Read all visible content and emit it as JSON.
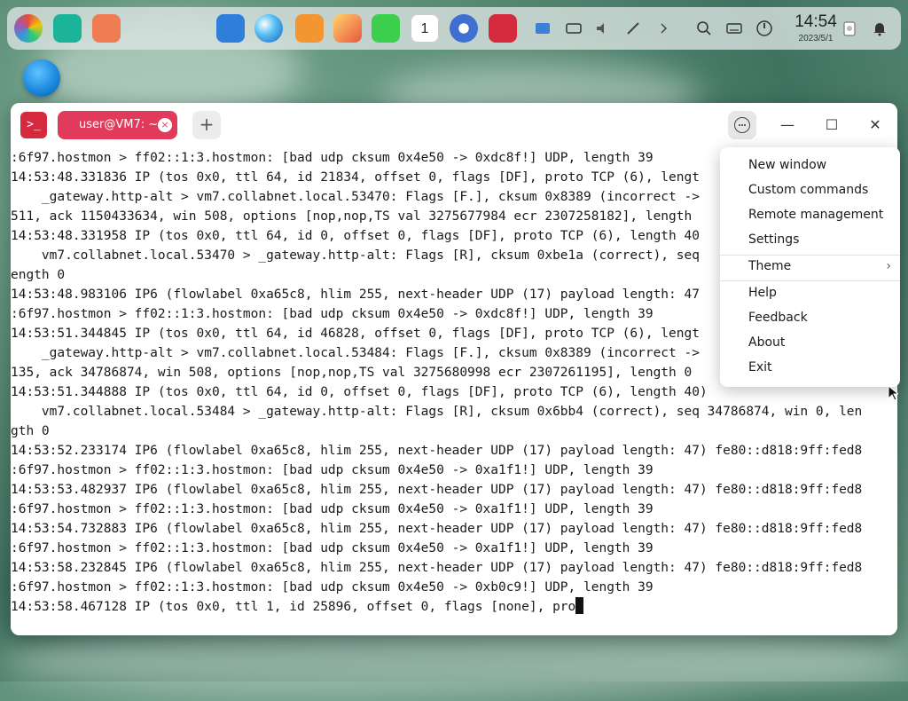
{
  "dock": {
    "clock_time": "14:54",
    "clock_date": "2023/5/1",
    "calendar_day": "1",
    "apps": [
      "launcher-icon",
      "file-manager-icon",
      "app-store-icon",
      "browser-icon",
      "installer-icon",
      "photo-icon",
      "music-icon",
      "calendar-icon",
      "settings-icon",
      "terminal-icon"
    ],
    "tray": [
      "screenshot-icon",
      "keyboard-icon",
      "volume-icon",
      "pen-icon",
      "chevron-right-icon",
      "search-icon",
      "keyboard-layout-icon",
      "power-icon",
      "trash-icon",
      "notification-icon"
    ]
  },
  "window": {
    "app_icon_glyph": ">_",
    "tab_label": "user@VM7: ~",
    "tab_close": "×",
    "add_tab": "+",
    "minimize": "—",
    "maximize": "☐",
    "close": "✕"
  },
  "terminal": {
    "lines": [
      ":6f97.hostmon > ff02::1:3.hostmon: [bad udp cksum 0x4e50 -> 0xdc8f!] UDP, length 39",
      "14:53:48.331836 IP (tos 0x0, ttl 64, id 21834, offset 0, flags [DF], proto TCP (6), lengt",
      "    _gateway.http-alt > vm7.collabnet.local.53470: Flags [F.], cksum 0x8389 (incorrect ->",
      "511, ack 1150433634, win 508, options [nop,nop,TS val 3275677984 ecr 2307258182], length",
      "14:53:48.331958 IP (tos 0x0, ttl 64, id 0, offset 0, flags [DF], proto TCP (6), length 40",
      "    vm7.collabnet.local.53470 > _gateway.http-alt: Flags [R], cksum 0xbe1a (correct), seq",
      "ength 0",
      "14:53:48.983106 IP6 (flowlabel 0xa65c8, hlim 255, next-header UDP (17) payload length: 47",
      ":6f97.hostmon > ff02::1:3.hostmon: [bad udp cksum 0x4e50 -> 0xdc8f!] UDP, length 39",
      "14:53:51.344845 IP (tos 0x0, ttl 64, id 46828, offset 0, flags [DF], proto TCP (6), lengt",
      "    _gateway.http-alt > vm7.collabnet.local.53484: Flags [F.], cksum 0x8389 (incorrect ->",
      "135, ack 34786874, win 508, options [nop,nop,TS val 3275680998 ecr 2307261195], length 0",
      "14:53:51.344888 IP (tos 0x0, ttl 64, id 0, offset 0, flags [DF], proto TCP (6), length 40)",
      "    vm7.collabnet.local.53484 > _gateway.http-alt: Flags [R], cksum 0x6bb4 (correct), seq 34786874, win 0, len",
      "gth 0",
      "14:53:52.233174 IP6 (flowlabel 0xa65c8, hlim 255, next-header UDP (17) payload length: 47) fe80::d818:9ff:fed8",
      ":6f97.hostmon > ff02::1:3.hostmon: [bad udp cksum 0x4e50 -> 0xa1f1!] UDP, length 39",
      "14:53:53.482937 IP6 (flowlabel 0xa65c8, hlim 255, next-header UDP (17) payload length: 47) fe80::d818:9ff:fed8",
      ":6f97.hostmon > ff02::1:3.hostmon: [bad udp cksum 0x4e50 -> 0xa1f1!] UDP, length 39",
      "14:53:54.732883 IP6 (flowlabel 0xa65c8, hlim 255, next-header UDP (17) payload length: 47) fe80::d818:9ff:fed8",
      ":6f97.hostmon > ff02::1:3.hostmon: [bad udp cksum 0x4e50 -> 0xa1f1!] UDP, length 39",
      "14:53:58.232845 IP6 (flowlabel 0xa65c8, hlim 255, next-header UDP (17) payload length: 47) fe80::d818:9ff:fed8",
      ":6f97.hostmon > ff02::1:3.hostmon: [bad udp cksum 0x4e50 -> 0xb0c9!] UDP, length 39",
      "14:53:58.467128 IP (tos 0x0, ttl 1, id 25896, offset 0, flags [none], pro"
    ]
  },
  "menu": {
    "items": [
      "New window",
      "Custom commands",
      "Remote management",
      "Settings",
      "Theme",
      "Help",
      "Feedback",
      "About",
      "Exit"
    ],
    "theme_chevron": "›"
  },
  "colors": {
    "tab_accent": "#e23a5a",
    "app_icon": "#d52a3d"
  }
}
